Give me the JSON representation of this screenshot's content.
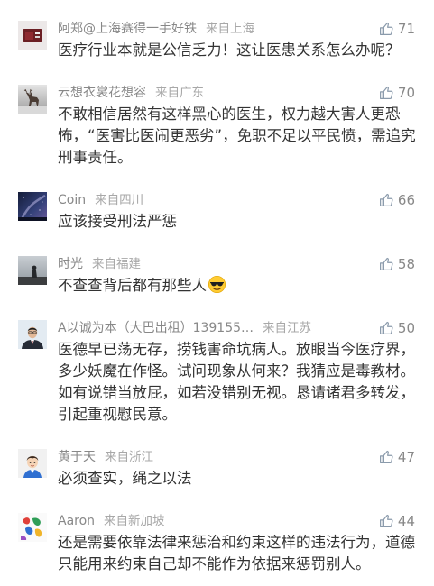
{
  "colors": {
    "background": "#ffffff",
    "username": "#888888",
    "location": "#a8a8a8",
    "comment_text": "#333333",
    "like_icon": "#8a9aab",
    "like_count": "#888888"
  },
  "like_icon": "thumbs-up-icon",
  "comments": [
    {
      "avatar": "avatar-dark-red-object",
      "username": "阿郑@上海赛得一手好铁",
      "location": "来自上海",
      "likes": "71",
      "text_lines": [
        "医疗行业本就是公信乏力！这让医患关系怎么办呢？"
      ]
    },
    {
      "avatar": "avatar-snowy-deer",
      "username": "云想衣裳花想容",
      "location": "来自广东",
      "likes": "70",
      "text_lines": [
        "不敢相信居然有这样黑心的医生，权力越大害人更恐",
        "怖，“医害比医闹更恶劣”，免职不足以平民愤，需追究",
        "刑事责任。"
      ]
    },
    {
      "avatar": "avatar-night-sky",
      "username": "Coin",
      "location": "来自四川",
      "likes": "66",
      "text_lines": [
        "应该接受刑法严惩"
      ]
    },
    {
      "avatar": "avatar-silhouette",
      "username": "时光",
      "location": "来自福建",
      "likes": "58",
      "text_lines": [
        "不查查背后都有那些人"
      ],
      "emoji": "smiling-face-with-sunglasses"
    },
    {
      "avatar": "avatar-man-in-suit",
      "username": "A以诚为本（大巴出租）139155…",
      "location": "来自江苏",
      "likes": "50",
      "text_lines": [
        "医德早已荡无存，捞钱害命坑病人。放眼当今医疗界，",
        "多少妖魔在作怪。试问现象从何来？我猜应是毒教材。",
        "如有说错当放屁，如若没错别无视。恳请诸君多转发，",
        "引起重视慰民意。"
      ]
    },
    {
      "avatar": "avatar-cartoon-person",
      "username": "黄于天",
      "location": "来自浙江",
      "likes": "47",
      "text_lines": [
        "必须查实，绳之以法"
      ]
    },
    {
      "avatar": "avatar-colorful",
      "username": "Aaron",
      "location": "来自新加坡",
      "likes": "44",
      "text_lines": [
        "还是需要依靠法律来惩治和约束这样的违法行为，道德",
        "只能用来约束自己却不能作为依据来惩罚别人。"
      ]
    }
  ]
}
